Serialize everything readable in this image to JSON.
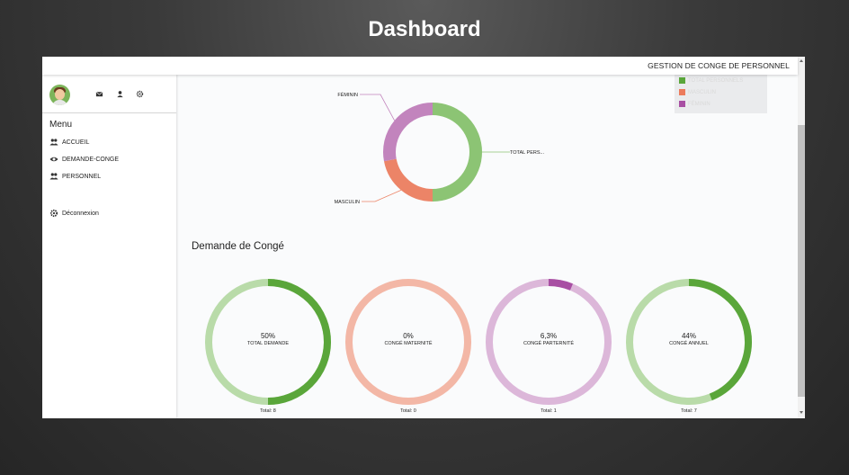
{
  "page": {
    "title": "Dashboard"
  },
  "topbar": {
    "title": "GESTION DE CONGE DE PERSONNEL"
  },
  "sidebar": {
    "menu_title": "Menu",
    "header_icons": [
      "envelope-icon",
      "user-icon",
      "gear-icon"
    ],
    "items": [
      {
        "label": "ACCUEIL",
        "icon": "users-icon"
      },
      {
        "label": "DEMANDE-CONGE",
        "icon": "eye-icon"
      },
      {
        "label": "PERSONNEL",
        "icon": "users-icon"
      },
      {
        "label": "Déconnexion",
        "icon": "gear-icon"
      }
    ]
  },
  "colors": {
    "green": "#5aa63a",
    "green_light": "#b9dba9",
    "orange": "#ec7b5c",
    "orange_light": "#f3b7a6",
    "purple": "#a84fa3",
    "purple_light": "#dcb7d9"
  },
  "chart_data": [
    {
      "type": "pie",
      "variant": "donut",
      "title": "",
      "legend": {
        "placement": "top-right",
        "entries": [
          {
            "label": "TOTAL PERSONNELS",
            "color": "#5aa63a"
          },
          {
            "label": "MASCULIN",
            "color": "#ec7b5c"
          },
          {
            "label": "FÉMININ",
            "color": "#a84fa3"
          }
        ]
      },
      "slices": [
        {
          "label": "TOTAL PERS...",
          "value": 50,
          "color": "#8cc474"
        },
        {
          "label": "MASCULIN",
          "value": 22,
          "color": "#ec8467"
        },
        {
          "label": "FÉMININ",
          "value": 28,
          "color": "#c284bd"
        }
      ]
    },
    {
      "type": "pie",
      "variant": "gauge",
      "title": "Demande de Congé",
      "gauges": [
        {
          "percent_text": "50%",
          "value": 50,
          "label": "TOTAL DEMANDE",
          "total": "Total: 8",
          "color": "#5aa63a",
          "track": "#b9dba9"
        },
        {
          "percent_text": "0%",
          "value": 0,
          "label": "CONGÉ MATERNITÉ",
          "total": "Total: 0",
          "color": "#ec7b5c",
          "track": "#f3b7a6"
        },
        {
          "percent_text": "6,3%",
          "value": 6.3,
          "label": "CONGÉ PARTERNITÉ",
          "total": "Total: 1",
          "color": "#a84fa3",
          "track": "#dcb7d9"
        },
        {
          "percent_text": "44%",
          "value": 44,
          "label": "CONGÉ ANNUEL",
          "total": "Total: 7",
          "color": "#5aa63a",
          "track": "#b9dba9"
        }
      ]
    }
  ]
}
